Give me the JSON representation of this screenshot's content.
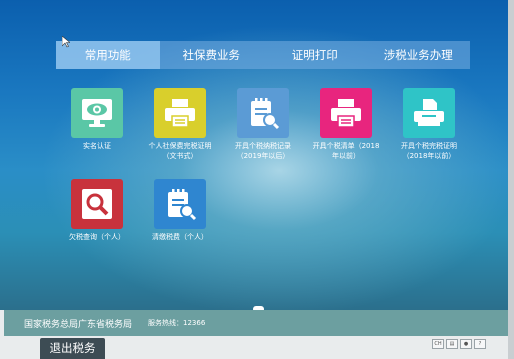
{
  "tabs": [
    "常用功能",
    "社保费业务",
    "证明打印",
    "涉税业务办理"
  ],
  "active_tab": 0,
  "tiles": [
    {
      "label": "实名认证",
      "icon": "monitor-eye-icon",
      "color": "#5ac7a6"
    },
    {
      "label": "个人社保费完税证明（文书式）",
      "icon": "printer-icon",
      "color": "#d9cf2c"
    },
    {
      "label": "开具个税纳税记录（2019年以后）",
      "icon": "document-search-icon",
      "color": "#5b9bd5"
    },
    {
      "label": "开具个税清单（2018年以前）",
      "icon": "printer-icon",
      "color": "#e8257e"
    },
    {
      "label": "开具个税完税证明（2018年以前）",
      "icon": "printer-paper-icon",
      "color": "#2fc4c7"
    },
    {
      "label": "欠税查询（个人）",
      "icon": "search-icon",
      "color": "#c8323c"
    },
    {
      "label": "清缴税费（个人）",
      "icon": "document-search-icon",
      "color": "#2f86d0"
    }
  ],
  "footer": {
    "org": "国家税务总局广东省税务局",
    "hotline": "服务热线：12366"
  },
  "exit_label": "退出税务",
  "tray": [
    "CH",
    "▤",
    "●",
    "?"
  ]
}
